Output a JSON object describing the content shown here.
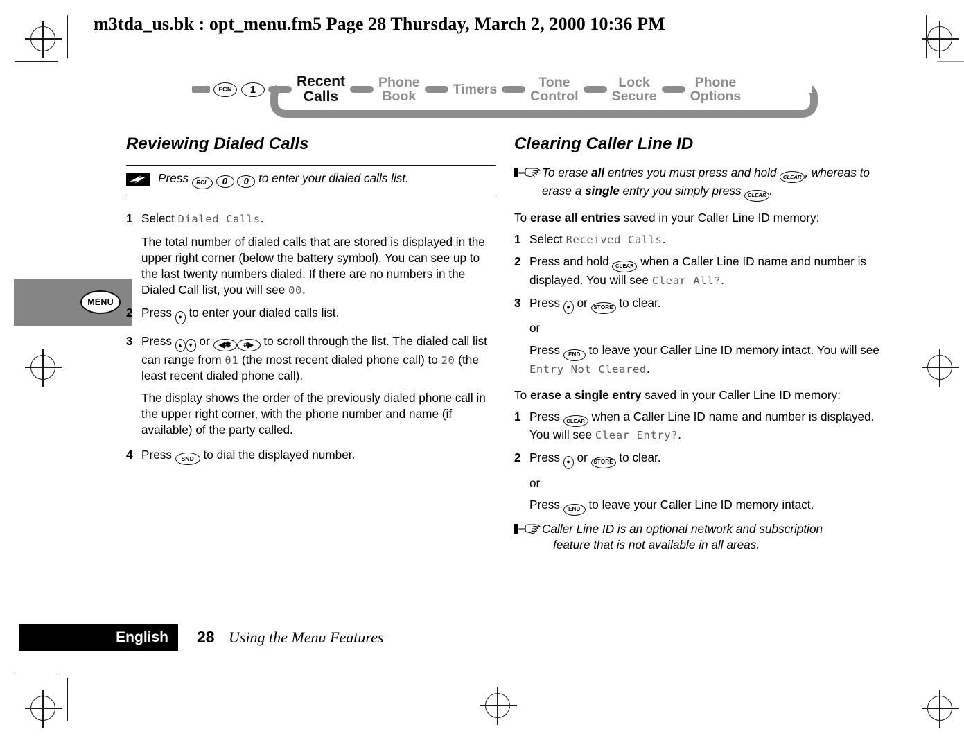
{
  "header": {
    "slug": "m3tda_us.bk : opt_menu.fm5  Page 28  Thursday, March 2, 2000  10:36 PM"
  },
  "navbar": {
    "keys": [
      {
        "label": "FCN",
        "name": "fcn-key"
      },
      {
        "label": "1",
        "name": "digit-1-key"
      }
    ],
    "tabs": [
      {
        "label": "Recent\nCalls",
        "active": true
      },
      {
        "label": "Phone\nBook",
        "active": false
      },
      {
        "label": "Timers",
        "active": false
      },
      {
        "label": "Tone\nControl",
        "active": false
      },
      {
        "label": "Lock\nSecure",
        "active": false
      },
      {
        "label": "Phone\nOptions",
        "active": false
      }
    ]
  },
  "side_tab": {
    "button_label": "MENU"
  },
  "left_column": {
    "heading": "Reviewing Dialed Calls",
    "shortcut": {
      "icon": "lightning-bolt-icon",
      "prefix": "Press",
      "keys": [
        "RCL",
        "0",
        "0"
      ],
      "suffix": "to enter your dialed calls list."
    },
    "steps": [
      {
        "num": "1",
        "lead": "Select",
        "lcd": "Dialed Calls",
        "tail": ".",
        "paragraphs": [
          "The total number of dialed calls that are stored is displayed in the upper right corner (below the battery symbol). You can see up to the last twenty numbers dialed. If there are no numbers in the Dialed Call list, you will see",
          "00",
          "."
        ]
      },
      {
        "num": "2",
        "text_before": "Press",
        "key": "nav-updown",
        "text_after": "to enter your dialed calls list."
      },
      {
        "num": "3",
        "t1": "Press",
        "t2": "or",
        "t3": "to scroll through the list. The dialed call list can range from",
        "lcd1": "01",
        "t4": "(the most recent dialed phone call) to",
        "lcd2": "20",
        "t5": "(the least recent dialed phone call).",
        "para": "The display shows the order of the previously dialed phone call in the upper right corner, with the phone number and name (if available) of the party called."
      },
      {
        "num": "4",
        "text_before": "Press",
        "key": "SND",
        "text_after": "to dial the displayed number."
      }
    ]
  },
  "right_column": {
    "heading": "Clearing Caller Line ID",
    "note_top": {
      "icon": "pointing-hand-icon",
      "part1": "To erase ",
      "bold1": "all",
      "part2": " entries you must press and hold ",
      "key1": "CLEAR",
      "part3": ", whereas to erase a ",
      "bold2": "single",
      "part4": " entry you simply press ",
      "key2": "CLEAR",
      "part5": "."
    },
    "intro_all": {
      "part1": "To ",
      "bold": "erase all entries",
      "part2": " saved in your Caller Line ID memory:"
    },
    "steps_all": [
      {
        "num": "1",
        "lead": "Select",
        "lcd": "Received Calls",
        "tail": "."
      },
      {
        "num": "2",
        "t1": "Press and hold",
        "key": "CLEAR",
        "t2": "when a Caller Line ID name and number is displayed. You will see",
        "lcd": "Clear All?",
        "tail": "."
      },
      {
        "num": "3",
        "t1": "Press",
        "t2": "or",
        "key": "STORE",
        "t3": "to clear.",
        "or": "or",
        "alt_t1": "Press",
        "alt_key": "END",
        "alt_t2": "to leave your Caller Line ID memory intact. You will see",
        "alt_lcd": "Entry Not Cleared",
        "alt_tail": "."
      }
    ],
    "intro_single": {
      "part1": "To ",
      "bold": "erase a single entry",
      "part2": " saved in your Caller Line ID memory:"
    },
    "steps_single": [
      {
        "num": "1",
        "t1": "Press",
        "key": "CLEAR",
        "t2": "when a Caller Line ID name and number is displayed. You will see",
        "lcd": "Clear Entry?",
        "tail": "."
      },
      {
        "num": "2",
        "t1": "Press",
        "t2": "or",
        "key": "STORE",
        "t3": "to clear.",
        "or": "or",
        "alt_t1": "Press",
        "alt_key": "END",
        "alt_t2": "to leave your Caller Line ID memory intact."
      }
    ],
    "note_bottom": {
      "icon": "pointing-hand-icon",
      "line1": "Caller Line ID is an optional network and subscription",
      "line2": "feature that is not available in all areas."
    }
  },
  "footer": {
    "language": "English",
    "page_number": "28",
    "section_title": "Using the Menu Features"
  },
  "colors": {
    "gray_tab": "#8d8d8d",
    "side_tab": "#858585",
    "lcd_text": "#5a5a5a",
    "ink": "#000000"
  }
}
